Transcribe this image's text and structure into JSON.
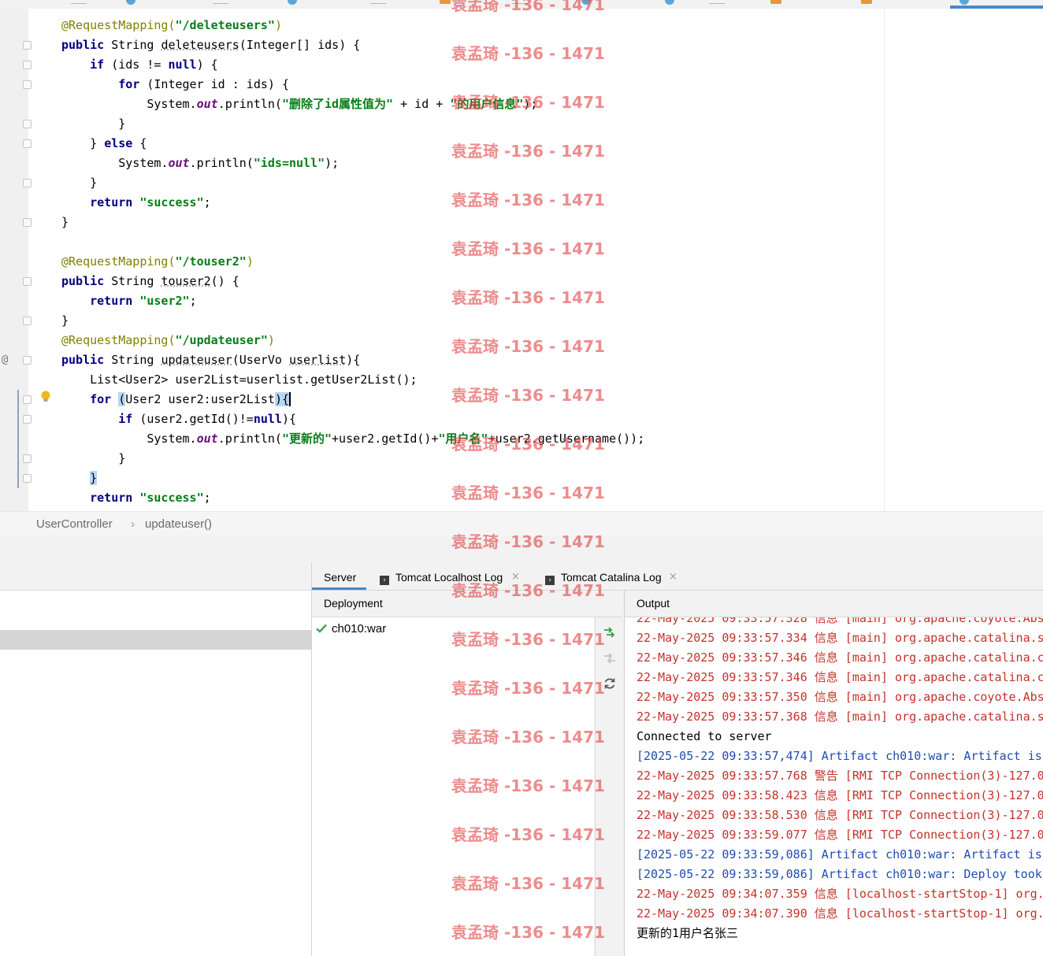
{
  "editor": {
    "lines": [
      [
        {
          "c": "an",
          "t": "@RequestMapping("
        },
        {
          "c": "s",
          "t": "\"/deleteusers\""
        },
        {
          "c": "an",
          "t": ")"
        }
      ],
      [
        {
          "c": "k",
          "t": "public "
        },
        {
          "t": "String "
        },
        {
          "c": "u",
          "t": "deleteusers"
        },
        {
          "t": "(Integer[] ids) {"
        }
      ],
      [
        {
          "t": "    "
        },
        {
          "c": "k",
          "t": "if "
        },
        {
          "t": "(ids != "
        },
        {
          "c": "k",
          "t": "null"
        },
        {
          "t": ") {"
        }
      ],
      [
        {
          "t": "        "
        },
        {
          "c": "k",
          "t": "for "
        },
        {
          "t": "(Integer id : ids) {"
        }
      ],
      [
        {
          "t": "            System."
        },
        {
          "c": "f",
          "t": "out"
        },
        {
          "t": ".println("
        },
        {
          "c": "s",
          "t": "\"删除了id属性值为\""
        },
        {
          "t": " + id + "
        },
        {
          "c": "s",
          "t": "\"的用户信息\""
        },
        {
          "t": ");"
        }
      ],
      [
        {
          "t": "        }"
        }
      ],
      [
        {
          "t": "    } "
        },
        {
          "c": "k",
          "t": "else "
        },
        {
          "t": "{"
        }
      ],
      [
        {
          "t": "        System."
        },
        {
          "c": "f",
          "t": "out"
        },
        {
          "t": ".println("
        },
        {
          "c": "s",
          "t": "\"ids=null\""
        },
        {
          "t": ");"
        }
      ],
      [
        {
          "t": "    }"
        }
      ],
      [
        {
          "t": "    "
        },
        {
          "c": "k",
          "t": "return "
        },
        {
          "c": "s",
          "t": "\"success\""
        },
        {
          "t": ";"
        }
      ],
      [
        {
          "t": "}"
        }
      ],
      [],
      [
        {
          "c": "an",
          "t": "@RequestMapping("
        },
        {
          "c": "s",
          "t": "\"/touser2\""
        },
        {
          "c": "an",
          "t": ")"
        }
      ],
      [
        {
          "c": "k",
          "t": "public "
        },
        {
          "t": "String "
        },
        {
          "c": "u",
          "t": "touser2"
        },
        {
          "t": "() {"
        }
      ],
      [
        {
          "t": "    "
        },
        {
          "c": "k",
          "t": "return "
        },
        {
          "c": "s",
          "t": "\"user2\""
        },
        {
          "t": ";"
        }
      ],
      [
        {
          "t": "}"
        }
      ],
      [
        {
          "c": "an",
          "t": "@RequestMapping("
        },
        {
          "c": "s",
          "t": "\"/updateuser\""
        },
        {
          "c": "an",
          "t": ")"
        }
      ],
      [
        {
          "c": "k",
          "t": "public "
        },
        {
          "t": "String "
        },
        {
          "c": "u",
          "t": "updateuser"
        },
        {
          "t": "(UserVo "
        },
        {
          "c": "u",
          "t": "userlist"
        },
        {
          "t": "){"
        }
      ],
      [
        {
          "t": "    List<User2> user2List=userlist.getUser2List();"
        }
      ],
      [
        {
          "t": "    "
        },
        {
          "c": "k",
          "t": "for "
        },
        {
          "c": "brk",
          "t": "("
        },
        {
          "t": "User2 user2:user2List"
        },
        {
          "c": "brk",
          "t": "){"
        },
        {
          "c": "cur",
          "t": ""
        }
      ],
      [
        {
          "t": "        "
        },
        {
          "c": "k",
          "t": "if "
        },
        {
          "t": "(user2.getId()!="
        },
        {
          "c": "k",
          "t": "null"
        },
        {
          "t": "){"
        }
      ],
      [
        {
          "t": "            System."
        },
        {
          "c": "f",
          "t": "out"
        },
        {
          "t": ".println("
        },
        {
          "c": "s",
          "t": "\"更新的\""
        },
        {
          "t": "+user2.getId()+"
        },
        {
          "c": "s",
          "t": "\"用户名\""
        },
        {
          "t": "+user2.getUsername());"
        }
      ],
      [
        {
          "t": "        }"
        }
      ],
      [
        {
          "t": "    "
        },
        {
          "c": "brk",
          "t": "}"
        }
      ],
      [
        {
          "t": "    "
        },
        {
          "c": "k",
          "t": "return "
        },
        {
          "c": "s",
          "t": "\"success\""
        },
        {
          "t": ";"
        }
      ]
    ]
  },
  "breadcrumb": {
    "class_name": "UserController",
    "separator": "›",
    "method_name": "updateuser()"
  },
  "services": {
    "tabs": [
      {
        "label": "Server",
        "active": true
      },
      {
        "label": "Tomcat Localhost Log",
        "icon": "terminal-icon",
        "close": "×"
      },
      {
        "label": "Tomcat Catalina Log",
        "icon": "terminal-icon",
        "close": "×"
      }
    ],
    "deployment_header": "Deployment",
    "output_header": "Output",
    "deployment_items": [
      {
        "label": "ch010:war",
        "status": "deployed",
        "icon": "check-icon"
      }
    ],
    "toolbar_icons": [
      "deploy-icon",
      "undeploy-icon",
      "redeploy-icon"
    ]
  },
  "output_lines": [
    {
      "text": "22-May-2025 09:33:57.328 信息 [main] org.apache.coyote.Abs",
      "color": "red"
    },
    {
      "text": "22-May-2025 09:33:57.334 信息 [main] org.apache.catalina.s",
      "color": "red"
    },
    {
      "text": "22-May-2025 09:33:57.346 信息 [main] org.apache.catalina.c",
      "color": "red"
    },
    {
      "text": "22-May-2025 09:33:57.346 信息 [main] org.apache.catalina.c",
      "color": "red"
    },
    {
      "text": "22-May-2025 09:33:57.350 信息 [main] org.apache.coyote.Abs",
      "color": "red"
    },
    {
      "text": "22-May-2025 09:33:57.368 信息 [main] org.apache.catalina.s",
      "color": "red"
    },
    {
      "text": "Connected to server",
      "color": "black"
    },
    {
      "text": "[2025-05-22 09:33:57,474] Artifact ch010:war: Artifact is",
      "color": "blue"
    },
    {
      "text": "22-May-2025 09:33:57.768 警告 [RMI TCP Connection(3)-127.0",
      "color": "red"
    },
    {
      "text": "22-May-2025 09:33:58.423 信息 [RMI TCP Connection(3)-127.0",
      "color": "red"
    },
    {
      "text": "22-May-2025 09:33:58.530 信息 [RMI TCP Connection(3)-127.0",
      "color": "red"
    },
    {
      "text": "22-May-2025 09:33:59.077 信息 [RMI TCP Connection(3)-127.0",
      "color": "red"
    },
    {
      "text": "[2025-05-22 09:33:59,086] Artifact ch010:war: Artifact is",
      "color": "blue"
    },
    {
      "text": "[2025-05-22 09:33:59,086] Artifact ch010:war: Deploy took",
      "color": "blue"
    },
    {
      "text": "22-May-2025 09:34:07.359 信息 [localhost-startStop-1] org.",
      "color": "red"
    },
    {
      "text": "22-May-2025 09:34:07.390 信息 [localhost-startStop-1] org.",
      "color": "red"
    },
    {
      "text": "更新的1用户名张三",
      "color": "black"
    }
  ],
  "watermark": {
    "text": "袁孟琦 -136 - 1471"
  },
  "colors": {
    "accent": "#4a88c7",
    "log_red": "#c4322a",
    "log_blue": "#1f4cb3",
    "string_green": "#067d17",
    "keyword_navy": "#000080",
    "watermark": "#e24646"
  }
}
